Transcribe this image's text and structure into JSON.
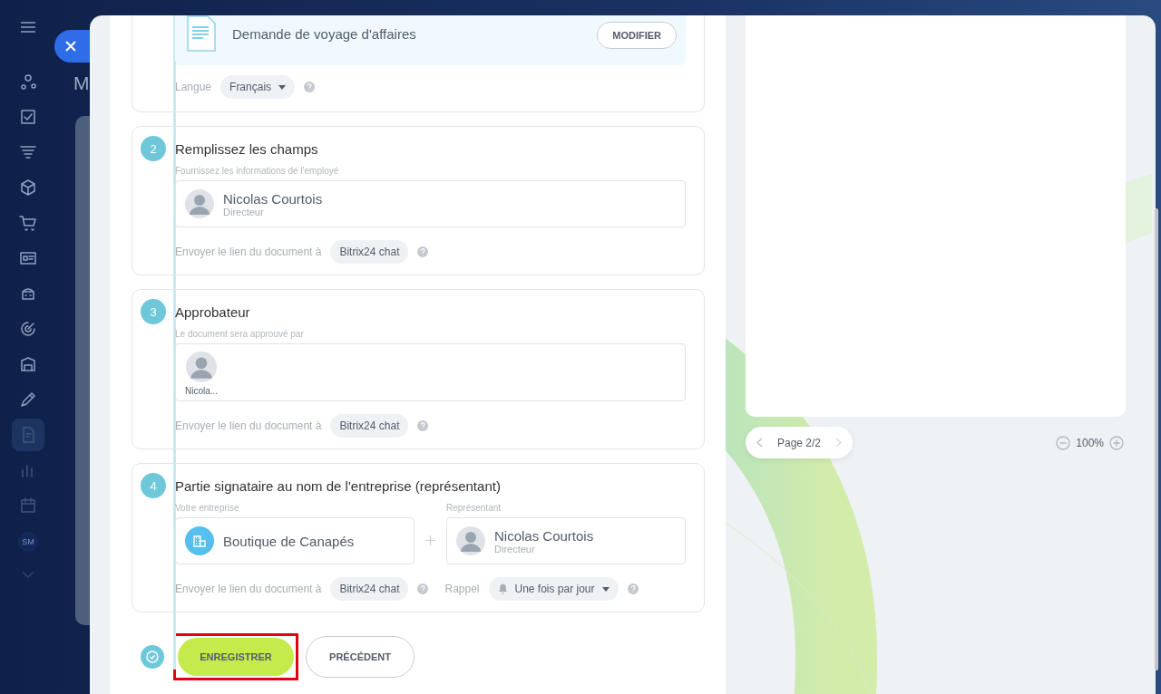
{
  "background": {
    "title_fragment": "M"
  },
  "sidebar": {
    "items": [
      {
        "selected": false
      },
      {
        "selected": false
      },
      {
        "selected": false
      },
      {
        "selected": false
      },
      {
        "selected": false
      },
      {
        "selected": false
      },
      {
        "selected": false
      },
      {
        "selected": false
      },
      {
        "selected": false
      },
      {
        "selected": false
      },
      {
        "selected": true
      },
      {
        "selected": false
      },
      {
        "selected": false
      }
    ],
    "avatar_initials": "SM"
  },
  "steps": [
    {
      "kind": "document",
      "document_title": "Demande de voyage d'affaires",
      "button": "MODIFIER",
      "language_label": "Langue",
      "language": "Français"
    },
    {
      "kind": "employee",
      "number": "2",
      "title": "Remplissez les champs",
      "hint": "Fournissez les informations de l'employé",
      "person": {
        "name": "Nicolas Courtois",
        "role": "Directeur"
      },
      "send_label": "Envoyer le lien du document à",
      "channel": "Bitrix24 chat"
    },
    {
      "kind": "approver",
      "number": "3",
      "title": "Approbateur",
      "hint": "Le document sera approuvé par",
      "person": {
        "name": "Nicola..."
      },
      "send_label": "Envoyer le lien du document à",
      "channel": "Bitrix24 chat"
    },
    {
      "kind": "company",
      "number": "4",
      "title": "Partie signataire au nom de l'entreprise (représentant)",
      "company_label": "Votre entreprise",
      "company": "Boutique de Canapés",
      "representative_label": "Représentant",
      "person": {
        "name": "Nicolas Courtois",
        "role": "Directeur"
      },
      "send_label": "Envoyer le lien du document à",
      "channel": "Bitrix24 chat",
      "reminder_label": "Rappel",
      "reminder": "Une fois par jour"
    }
  ],
  "actions": {
    "save": "ENREGISTRER",
    "save_highlighted": true,
    "back": "PRÉCÉDENT"
  },
  "preview": {
    "page": "Page 2/2",
    "zoom": "100%"
  }
}
